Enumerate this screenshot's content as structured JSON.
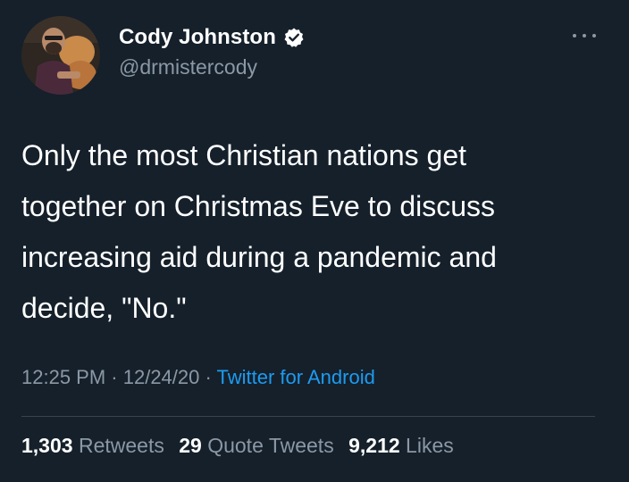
{
  "author": {
    "display_name": "Cody Johnston",
    "handle": "@drmistercody",
    "verified_icon": "verified-badge-icon",
    "avatar_icon": "profile-photo"
  },
  "more_icon": "more-horizontal-icon",
  "tweet": {
    "lines": [
      "Only the most Christian nations get",
      "together on Christmas Eve to discuss",
      "increasing aid during a pandemic and",
      "decide, \"No.\""
    ],
    "time": "12:25 PM",
    "separator": " · ",
    "date": "12/24/20",
    "source": "Twitter for Android"
  },
  "stats": {
    "retweets_count": "1,303",
    "retweets_label": "Retweets",
    "quotes_count": "29",
    "quotes_label": "Quote Tweets",
    "likes_count": "9,212",
    "likes_label": "Likes"
  },
  "colors": {
    "background": "#15202b",
    "text": "#ffffff",
    "secondary": "#8b98a5",
    "link": "#1d9bf0",
    "divider": "#38444d"
  }
}
